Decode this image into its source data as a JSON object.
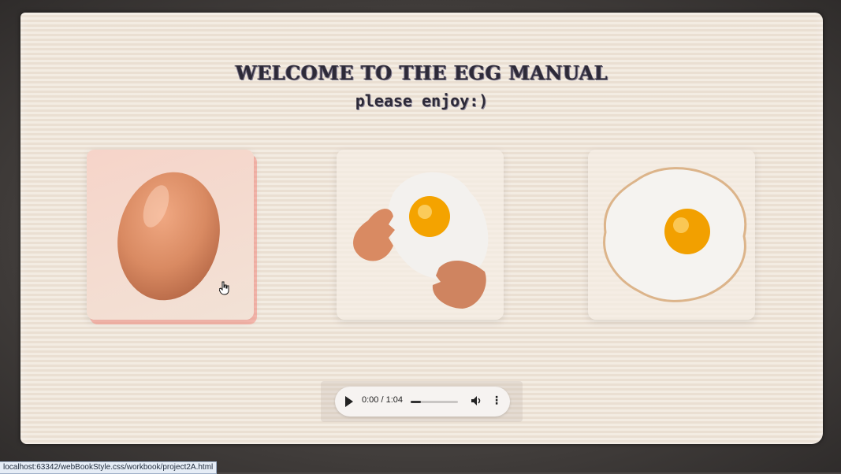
{
  "page": {
    "title": "WELCOME TO THE EGG MANUAL",
    "subtitle": "please enjoy:)"
  },
  "cards": [
    {
      "name": "whole-egg",
      "state": "hover"
    },
    {
      "name": "cracked-egg",
      "state": "normal"
    },
    {
      "name": "fried-egg",
      "state": "normal"
    }
  ],
  "audio": {
    "current_time": "0:00",
    "separator": " / ",
    "duration": "1:04",
    "progress_fraction": 0.22
  },
  "status_bar": {
    "url": "localhost:63342/webBookStyle.css/workbook/project2A.html"
  },
  "colors": {
    "page_bg": "#efe5d9",
    "title": "#2d2a38",
    "hover_shadow": "#f58c82",
    "yolk": "#f2a000"
  }
}
